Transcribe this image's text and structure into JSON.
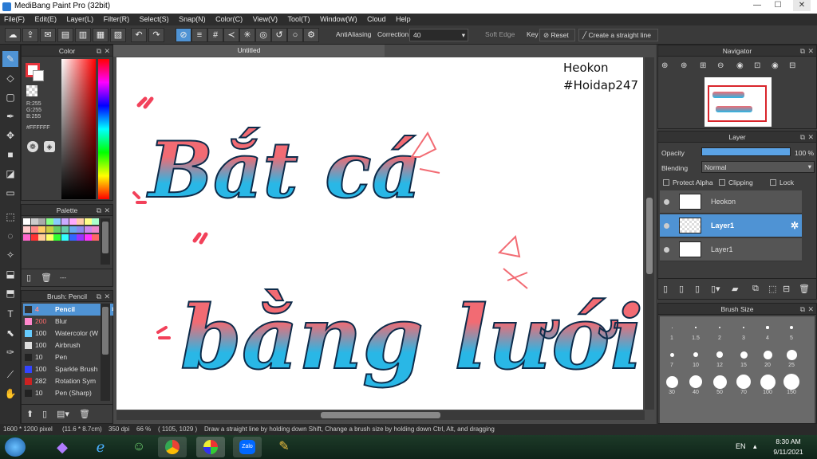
{
  "window": {
    "title": "MediBang Paint Pro (32bit)",
    "min": "—",
    "max": "☐",
    "close": "✕"
  },
  "menu": [
    "File(F)",
    "Edit(E)",
    "Layer(L)",
    "Filter(R)",
    "Select(S)",
    "Snap(N)",
    "Color(C)",
    "View(V)",
    "Tool(T)",
    "Window(W)",
    "Cloud",
    "Help"
  ],
  "toolbar": {
    "antialiasing": "AntiAliasing",
    "correction_label": "Correction",
    "correction_value": "40",
    "soft_edge": "Soft Edge",
    "key_label": "Key",
    "reset": "Reset",
    "straight_line": "Create a straight line"
  },
  "color_panel": {
    "title": "Color",
    "r": "R:255",
    "g": "G:255",
    "b": "B:255",
    "hex": "#FFFFFF"
  },
  "palette_panel": {
    "title": "Palette",
    "dashes": "---"
  },
  "palette_colors": [
    "#ffffff",
    "#cccccc",
    "#aaaaaa",
    "#88ff88",
    "#88ccff",
    "#ccaaff",
    "#ffaaff",
    "#ffccaa",
    "#ffff88",
    "#aaffcc",
    "#ffcccc",
    "#ff8888",
    "#ffcc66",
    "#cccc44",
    "#66cc66",
    "#66ccaa",
    "#66aaee",
    "#8888ee",
    "#cc88ee",
    "#ee88cc",
    "#ff66cc",
    "#ff3333",
    "#ffcc99",
    "#ffff66",
    "#33ff33",
    "#33ffff",
    "#3366ff",
    "#9933ff",
    "#ff33ff",
    "#ff6666"
  ],
  "brush_panel": {
    "title": "Brush: Pencil",
    "items": [
      {
        "size": "4",
        "name": "Pencil",
        "color": "#333333"
      },
      {
        "size": "200",
        "name": "Blur",
        "color": "#ff88cc"
      },
      {
        "size": "100",
        "name": "Watercolor (W",
        "color": "#66ccff"
      },
      {
        "size": "100",
        "name": "Airbrush",
        "color": "#dddddd"
      },
      {
        "size": "10",
        "name": "Pen",
        "color": "#222222"
      },
      {
        "size": "100",
        "name": "Sparkle Brush",
        "color": "#3344ff"
      },
      {
        "size": "282",
        "name": "Rotation Sym",
        "color": "#cc2222"
      },
      {
        "size": "10",
        "name": "Pen (Sharp)",
        "color": "#222222"
      }
    ]
  },
  "document": {
    "tab": "Untitled",
    "watermark_line1": "Heokon",
    "watermark_line2": "#Hoidap247",
    "art_line1": "Bắt cá",
    "art_line2": "bằng lưới"
  },
  "navigator": {
    "title": "Navigator"
  },
  "layer_panel": {
    "title": "Layer",
    "opacity_label": "Opacity",
    "opacity_value": "100 %",
    "opacity_fraction": 1.0,
    "blending_label": "Blending",
    "blending_value": "Normal",
    "protect_alpha": "Protect Alpha",
    "clipping": "Clipping",
    "lock": "Lock",
    "layers": [
      {
        "name": "Heokon",
        "selected": false
      },
      {
        "name": "Layer1",
        "selected": true
      },
      {
        "name": "Layer1",
        "selected": false
      }
    ]
  },
  "brush_size_panel": {
    "title": "Brush Size",
    "sizes": [
      "1",
      "1.5",
      "2",
      "3",
      "4",
      "5",
      "7",
      "10",
      "12",
      "15",
      "20",
      "25",
      "30",
      "40",
      "50",
      "70",
      "100",
      "150"
    ]
  },
  "status": {
    "dimensions": "1600 * 1200 pixel",
    "physical": "(11.6 * 8.7cm)",
    "dpi": "350 dpi",
    "zoom": "66 %",
    "coords": "( 1105, 1029 )",
    "hint": "Draw a straight line by holding down Shift, Change a brush size by holding down Ctrl, Alt, and dragging"
  },
  "taskbar": {
    "lang": "EN",
    "time": "8:30 AM",
    "date": "9/11/2021",
    "zalo": "Zalo"
  },
  "colors": {
    "accent": "#4f93d4",
    "art_pink": "#f26b73",
    "art_blue": "#29b7e6"
  }
}
